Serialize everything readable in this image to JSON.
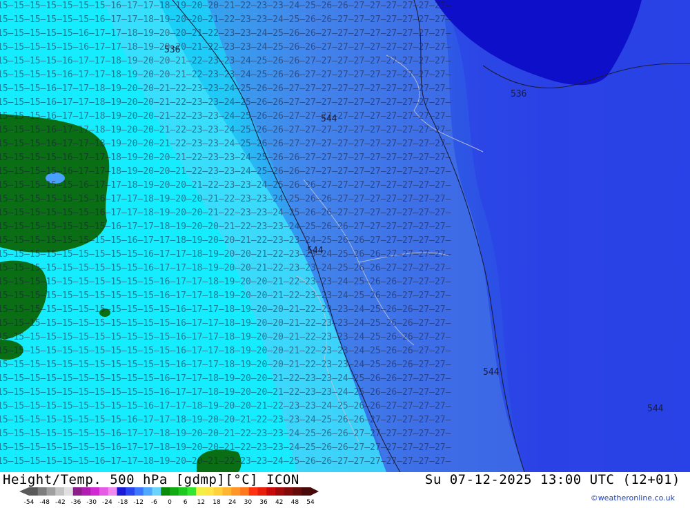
{
  "map": {
    "title": "Height/Temp. 500 hPa [gdmp][°C] ICON",
    "valid_time": "Su 07-12-2025 13:00 UTC (12+01)",
    "credit": "©weatheronline.co.uk",
    "spot_labels": [
      "536",
      "544",
      "544",
      "544",
      "536",
      "544"
    ],
    "colors": {
      "land": "#0a6e14",
      "t_warm": "#00e5ff",
      "t_cold": "#1014c8",
      "contour": "#1b1b3a",
      "border": "#c0c0d0"
    }
  },
  "legend": {
    "colors": [
      "#5a5a5a",
      "#7d7d7d",
      "#a0a0a0",
      "#c4c4c4",
      "#e0e0e0",
      "#8a1e8a",
      "#b11db1",
      "#d22ad2",
      "#e65ae6",
      "#f08cf0",
      "#1a1ad6",
      "#2a46f0",
      "#3c78ff",
      "#50a8ff",
      "#6ad4ff",
      "#0a8c0a",
      "#12aa12",
      "#1ec81e",
      "#32e632",
      "#f0f046",
      "#ffe646",
      "#ffd23c",
      "#ffb432",
      "#ff9628",
      "#ff781e",
      "#ff3214",
      "#e61e0a",
      "#c80a0a",
      "#a00a0a",
      "#820a0a",
      "#640a0a",
      "#460a0a"
    ],
    "labels": [
      "-54",
      "-48",
      "-42",
      "-36",
      "-30",
      "-24",
      "-18",
      "-12",
      "-6",
      "0",
      "6",
      "12",
      "18",
      "24",
      "30",
      "36",
      "42",
      "48",
      "54"
    ]
  }
}
